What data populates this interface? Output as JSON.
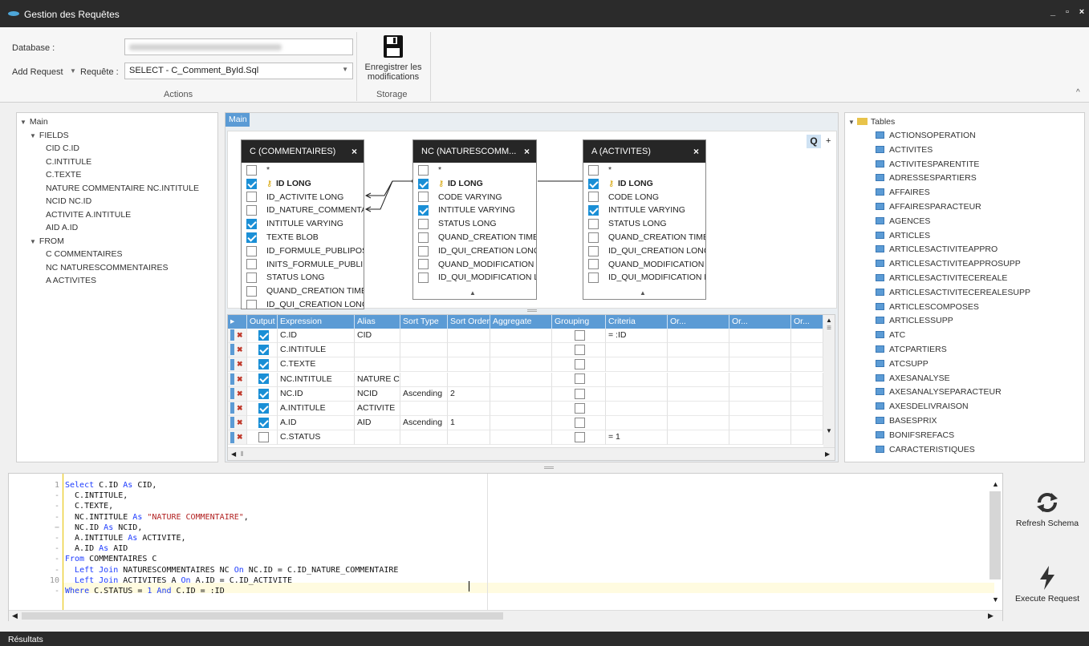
{
  "window": {
    "title": "Gestion des Requêtes",
    "minimize": "_",
    "maximize": "▫",
    "close": "×"
  },
  "ribbon": {
    "database_label": "Database :",
    "add_request_label": "Add Request",
    "requete_label": "Requête :",
    "requete_value": "SELECT - C_Comment_ById.Sql",
    "save_label_1": "Enregistrer les",
    "save_label_2": "modifications",
    "group_actions": "Actions",
    "group_storage": "Storage"
  },
  "tree": {
    "main": "Main",
    "fields": "FIELDS",
    "field_items": [
      "CID C.ID",
      "C.INTITULE",
      "C.TEXTE",
      "NATURE COMMENTAIRE NC.INTITULE",
      "NCID NC.ID",
      "ACTIVITE A.INTITULE",
      "AID A.ID"
    ],
    "from": "FROM",
    "from_items": [
      "C COMMENTAIRES",
      "NC NATURESCOMMENTAIRES",
      "A ACTIVITES"
    ]
  },
  "designer": {
    "tab": "Main",
    "q_btn": "Q",
    "plus_btn": "+",
    "tables": [
      {
        "title": "C (COMMENTAIRES)",
        "fields": [
          {
            "name": "*",
            "checked": false,
            "key": false
          },
          {
            "name": "ID LONG",
            "checked": true,
            "key": true
          },
          {
            "name": "ID_ACTIVITE LONG",
            "checked": false,
            "key": false
          },
          {
            "name": "ID_NATURE_COMMENTAII",
            "checked": false,
            "key": false
          },
          {
            "name": "INTITULE VARYING",
            "checked": true,
            "key": false
          },
          {
            "name": "TEXTE BLOB",
            "checked": true,
            "key": false
          },
          {
            "name": "ID_FORMULE_PUBLIPOST.",
            "checked": false,
            "key": false
          },
          {
            "name": "INITS_FORMULE_PUBLIPC",
            "checked": false,
            "key": false
          },
          {
            "name": "STATUS LONG",
            "checked": false,
            "key": false
          },
          {
            "name": "QUAND_CREATION TIMES",
            "checked": false,
            "key": false
          },
          {
            "name": "ID_QUI_CREATION LONG",
            "checked": false,
            "key": false
          }
        ]
      },
      {
        "title": "NC (NATURESCOMM...",
        "fields": [
          {
            "name": "*",
            "checked": false,
            "key": false
          },
          {
            "name": "ID LONG",
            "checked": true,
            "key": true
          },
          {
            "name": "CODE VARYING",
            "checked": false,
            "key": false
          },
          {
            "name": "INTITULE VARYING",
            "checked": true,
            "key": false
          },
          {
            "name": "STATUS LONG",
            "checked": false,
            "key": false
          },
          {
            "name": "QUAND_CREATION TIMES",
            "checked": false,
            "key": false
          },
          {
            "name": "ID_QUI_CREATION LONG",
            "checked": false,
            "key": false
          },
          {
            "name": "QUAND_MODIFICATION T",
            "checked": false,
            "key": false
          },
          {
            "name": "ID_QUI_MODIFICATION L",
            "checked": false,
            "key": false
          }
        ]
      },
      {
        "title": "A (ACTIVITES)",
        "fields": [
          {
            "name": "*",
            "checked": false,
            "key": false
          },
          {
            "name": "ID LONG",
            "checked": true,
            "key": true
          },
          {
            "name": "CODE LONG",
            "checked": false,
            "key": false
          },
          {
            "name": "INTITULE VARYING",
            "checked": true,
            "key": false
          },
          {
            "name": "STATUS LONG",
            "checked": false,
            "key": false
          },
          {
            "name": "QUAND_CREATION TIMES",
            "checked": false,
            "key": false
          },
          {
            "name": "ID_QUI_CREATION LONG",
            "checked": false,
            "key": false
          },
          {
            "name": "QUAND_MODIFICATION T",
            "checked": false,
            "key": false
          },
          {
            "name": "ID_QUI_MODIFICATION L",
            "checked": false,
            "key": false
          }
        ]
      }
    ]
  },
  "grid": {
    "headers": [
      "Output",
      "Expression",
      "Alias",
      "Sort Type",
      "Sort Order",
      "Aggregate",
      "Grouping",
      "Criteria",
      "Or...",
      "Or...",
      "Or..."
    ],
    "rows": [
      {
        "output": true,
        "expression": "C.ID",
        "alias": "CID",
        "sort_type": "",
        "sort_order": "",
        "grouping": false,
        "criteria": "= :ID"
      },
      {
        "output": true,
        "expression": "C.INTITULE",
        "alias": "",
        "sort_type": "",
        "sort_order": "",
        "grouping": false,
        "criteria": ""
      },
      {
        "output": true,
        "expression": "C.TEXTE",
        "alias": "",
        "sort_type": "",
        "sort_order": "",
        "grouping": false,
        "criteria": ""
      },
      {
        "output": true,
        "expression": "NC.INTITULE",
        "alias": "NATURE CO",
        "sort_type": "",
        "sort_order": "",
        "grouping": false,
        "criteria": ""
      },
      {
        "output": true,
        "expression": "NC.ID",
        "alias": "NCID",
        "sort_type": "Ascending",
        "sort_order": "2",
        "grouping": false,
        "criteria": ""
      },
      {
        "output": true,
        "expression": "A.INTITULE",
        "alias": "ACTIVITE",
        "sort_type": "",
        "sort_order": "",
        "grouping": false,
        "criteria": ""
      },
      {
        "output": true,
        "expression": "A.ID",
        "alias": "AID",
        "sort_type": "Ascending",
        "sort_order": "1",
        "grouping": false,
        "criteria": ""
      },
      {
        "output": false,
        "expression": "C.STATUS",
        "alias": "",
        "sort_type": "",
        "sort_order": "",
        "grouping": false,
        "criteria": "= 1"
      }
    ]
  },
  "tables_tree": {
    "root": "Tables",
    "items": [
      "ACTIONSOPERATION",
      "ACTIVITES",
      "ACTIVITESPARENTITE",
      "ADRESSESPARTIERS",
      "AFFAIRES",
      "AFFAIRESPARACTEUR",
      "AGENCES",
      "ARTICLES",
      "ARTICLESACTIVITEAPPRO",
      "ARTICLESACTIVITEAPPROSUPP",
      "ARTICLESACTIVITECEREALE",
      "ARTICLESACTIVITECEREALESUPP",
      "ARTICLESCOMPOSES",
      "ARTICLESSUPP",
      "ATC",
      "ATCPARTIERS",
      "ATCSUPP",
      "AXESANALYSE",
      "AXESANALYSEPARACTEUR",
      "AXESDELIVRAISON",
      "BASESPRIX",
      "BONIFSREFACS",
      "CARACTERISTIQUES"
    ]
  },
  "editor": {
    "line_numbers": [
      "1",
      "-",
      "-",
      "-",
      "−",
      "-",
      "-",
      "-",
      "-",
      "10",
      "-"
    ],
    "lines": [
      [
        {
          "t": "Select",
          "k": "kw"
        },
        {
          "t": " C.ID ",
          "k": ""
        },
        {
          "t": "As",
          "k": "kw"
        },
        {
          "t": " CID,",
          "k": ""
        }
      ],
      [
        {
          "t": "  C.INTITULE,",
          "k": ""
        }
      ],
      [
        {
          "t": "  C.TEXTE,",
          "k": ""
        }
      ],
      [
        {
          "t": "  NC.INTITULE ",
          "k": ""
        },
        {
          "t": "As",
          "k": "kw"
        },
        {
          "t": " ",
          "k": ""
        },
        {
          "t": "\"NATURE COMMENTAIRE\"",
          "k": "str"
        },
        {
          "t": ",",
          "k": ""
        }
      ],
      [
        {
          "t": "  NC.ID ",
          "k": ""
        },
        {
          "t": "As",
          "k": "kw"
        },
        {
          "t": " NCID,",
          "k": ""
        }
      ],
      [
        {
          "t": "  A.INTITULE ",
          "k": ""
        },
        {
          "t": "As",
          "k": "kw"
        },
        {
          "t": " ACTIVITE,",
          "k": ""
        }
      ],
      [
        {
          "t": "  A.ID ",
          "k": ""
        },
        {
          "t": "As",
          "k": "kw"
        },
        {
          "t": " AID",
          "k": ""
        }
      ],
      [
        {
          "t": "From",
          "k": "kw"
        },
        {
          "t": " COMMENTAIRES C",
          "k": ""
        }
      ],
      [
        {
          "t": "  ",
          "k": ""
        },
        {
          "t": "Left Join",
          "k": "kw"
        },
        {
          "t": " NATURESCOMMENTAIRES NC ",
          "k": ""
        },
        {
          "t": "On",
          "k": "kw"
        },
        {
          "t": " NC.ID = C.ID_NATURE_COMMENTAIRE",
          "k": ""
        }
      ],
      [
        {
          "t": "  ",
          "k": ""
        },
        {
          "t": "Left Join",
          "k": "kw"
        },
        {
          "t": " ACTIVITES A ",
          "k": ""
        },
        {
          "t": "On",
          "k": "kw"
        },
        {
          "t": " A.ID = C.ID_ACTIVITE",
          "k": ""
        }
      ],
      [
        {
          "t": "Where",
          "k": "kw"
        },
        {
          "t": " C.STATUS = ",
          "k": ""
        },
        {
          "t": "1",
          "k": "kw"
        },
        {
          "t": " ",
          "k": ""
        },
        {
          "t": "And",
          "k": "kw"
        },
        {
          "t": " C.ID = :ID",
          "k": ""
        }
      ]
    ]
  },
  "side_buttons": {
    "refresh": "Refresh Schema",
    "execute": "Execute Request"
  },
  "status": {
    "label": "Résultats"
  },
  "colors": {
    "accent": "#1a8fd6",
    "grid_header": "#5b9bd5",
    "titlebar": "#2b2b2b"
  }
}
